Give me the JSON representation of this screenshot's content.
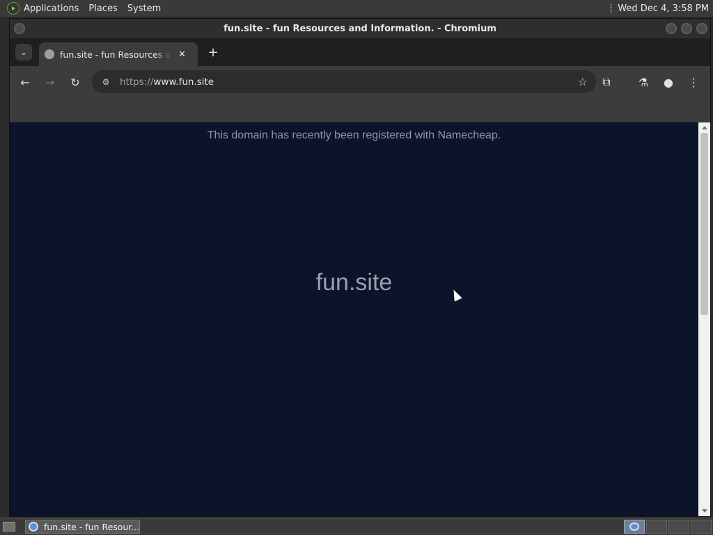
{
  "top_panel": {
    "menus": [
      "Applications",
      "Places",
      "System"
    ],
    "clock": "Wed Dec  4,  3:58 PM"
  },
  "window": {
    "title": "fun.site - fun Resources and Information. - Chromium"
  },
  "browser": {
    "tab": {
      "title": "fun.site - fun Resources and Information.",
      "close_glyph": "✕"
    },
    "new_tab_glyph": "+",
    "tab_list_glyph": "⌄",
    "toolbar": {
      "back_glyph": "←",
      "forward_glyph": "→",
      "reload_glyph": "↻",
      "site_info_glyph": "⚙",
      "bookmark_glyph": "☆",
      "extensions_glyph": "⧉",
      "labs_glyph": "⚗",
      "profile_glyph": "●",
      "menu_glyph": "⋮"
    },
    "omnibox": {
      "scheme": "https://",
      "host": "www.fun.site"
    }
  },
  "page": {
    "notice": "This domain has recently been registered with Namecheap.",
    "domain": "fun.site"
  },
  "taskbar": {
    "task_title": "fun.site - fun Resour..."
  },
  "colors": {
    "page_background": "#0c142a",
    "page_text": "#9aa0b0",
    "chrome_toolbar": "#3c3c3c",
    "panel": "#3a3a3a"
  }
}
